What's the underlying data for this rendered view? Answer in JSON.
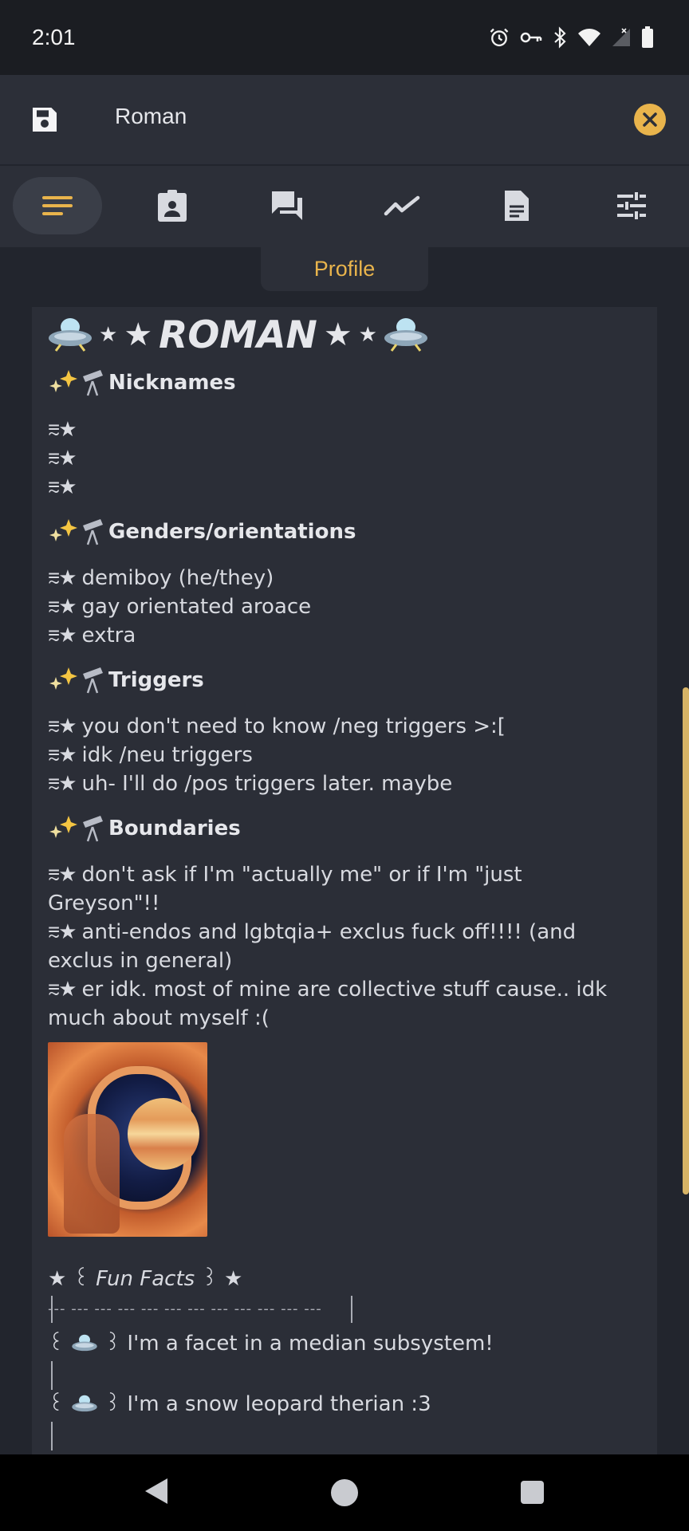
{
  "status_bar": {
    "time": "2:01",
    "icons": [
      "alarm-icon",
      "vpn-key-icon",
      "bluetooth-icon",
      "wifi-icon",
      "signal-icon",
      "battery-icon"
    ]
  },
  "top_bar": {
    "title": "Roman",
    "save_icon": "save-icon",
    "close_icon": "close-icon",
    "accent_color": "#e9b44c"
  },
  "tabs": {
    "items": [
      "menu-lines-icon",
      "id-badge-icon",
      "chat-icon",
      "graph-icon",
      "document-icon",
      "sliders-icon"
    ],
    "active_label": "Profile"
  },
  "profile": {
    "title": "ROMAN",
    "sections": [
      {
        "header": "Nicknames",
        "lines": [
          "",
          "",
          ""
        ]
      },
      {
        "header": "Genders/orientations",
        "lines": [
          "demiboy (he/they)",
          "gay orientated aroace",
          "extra"
        ]
      },
      {
        "header": "Triggers",
        "lines": [
          "you don't need to know /neg triggers >:[",
          "idk /neu triggers",
          "uh- I'll do /pos triggers later. maybe"
        ]
      },
      {
        "header": "Boundaries",
        "lines": [
          "don't ask if I'm \"actually me\" or if I'm \"just Greyson\"!!",
          "anti-endos and lgbtqia+ exclus fuck off!!!! (and exclus in general)",
          "er idk. most of mine are collective stuff cause.. idk much about myself :("
        ]
      }
    ],
    "fun_facts_title": "Fun Facts",
    "fun_facts": [
      "I'm a facet in a median subsystem!",
      "I'm a snow leopard therian :3"
    ],
    "bullet": "⩳★",
    "divider": "--- --- --- --- --- --- --- --- --- --- --- ---"
  }
}
